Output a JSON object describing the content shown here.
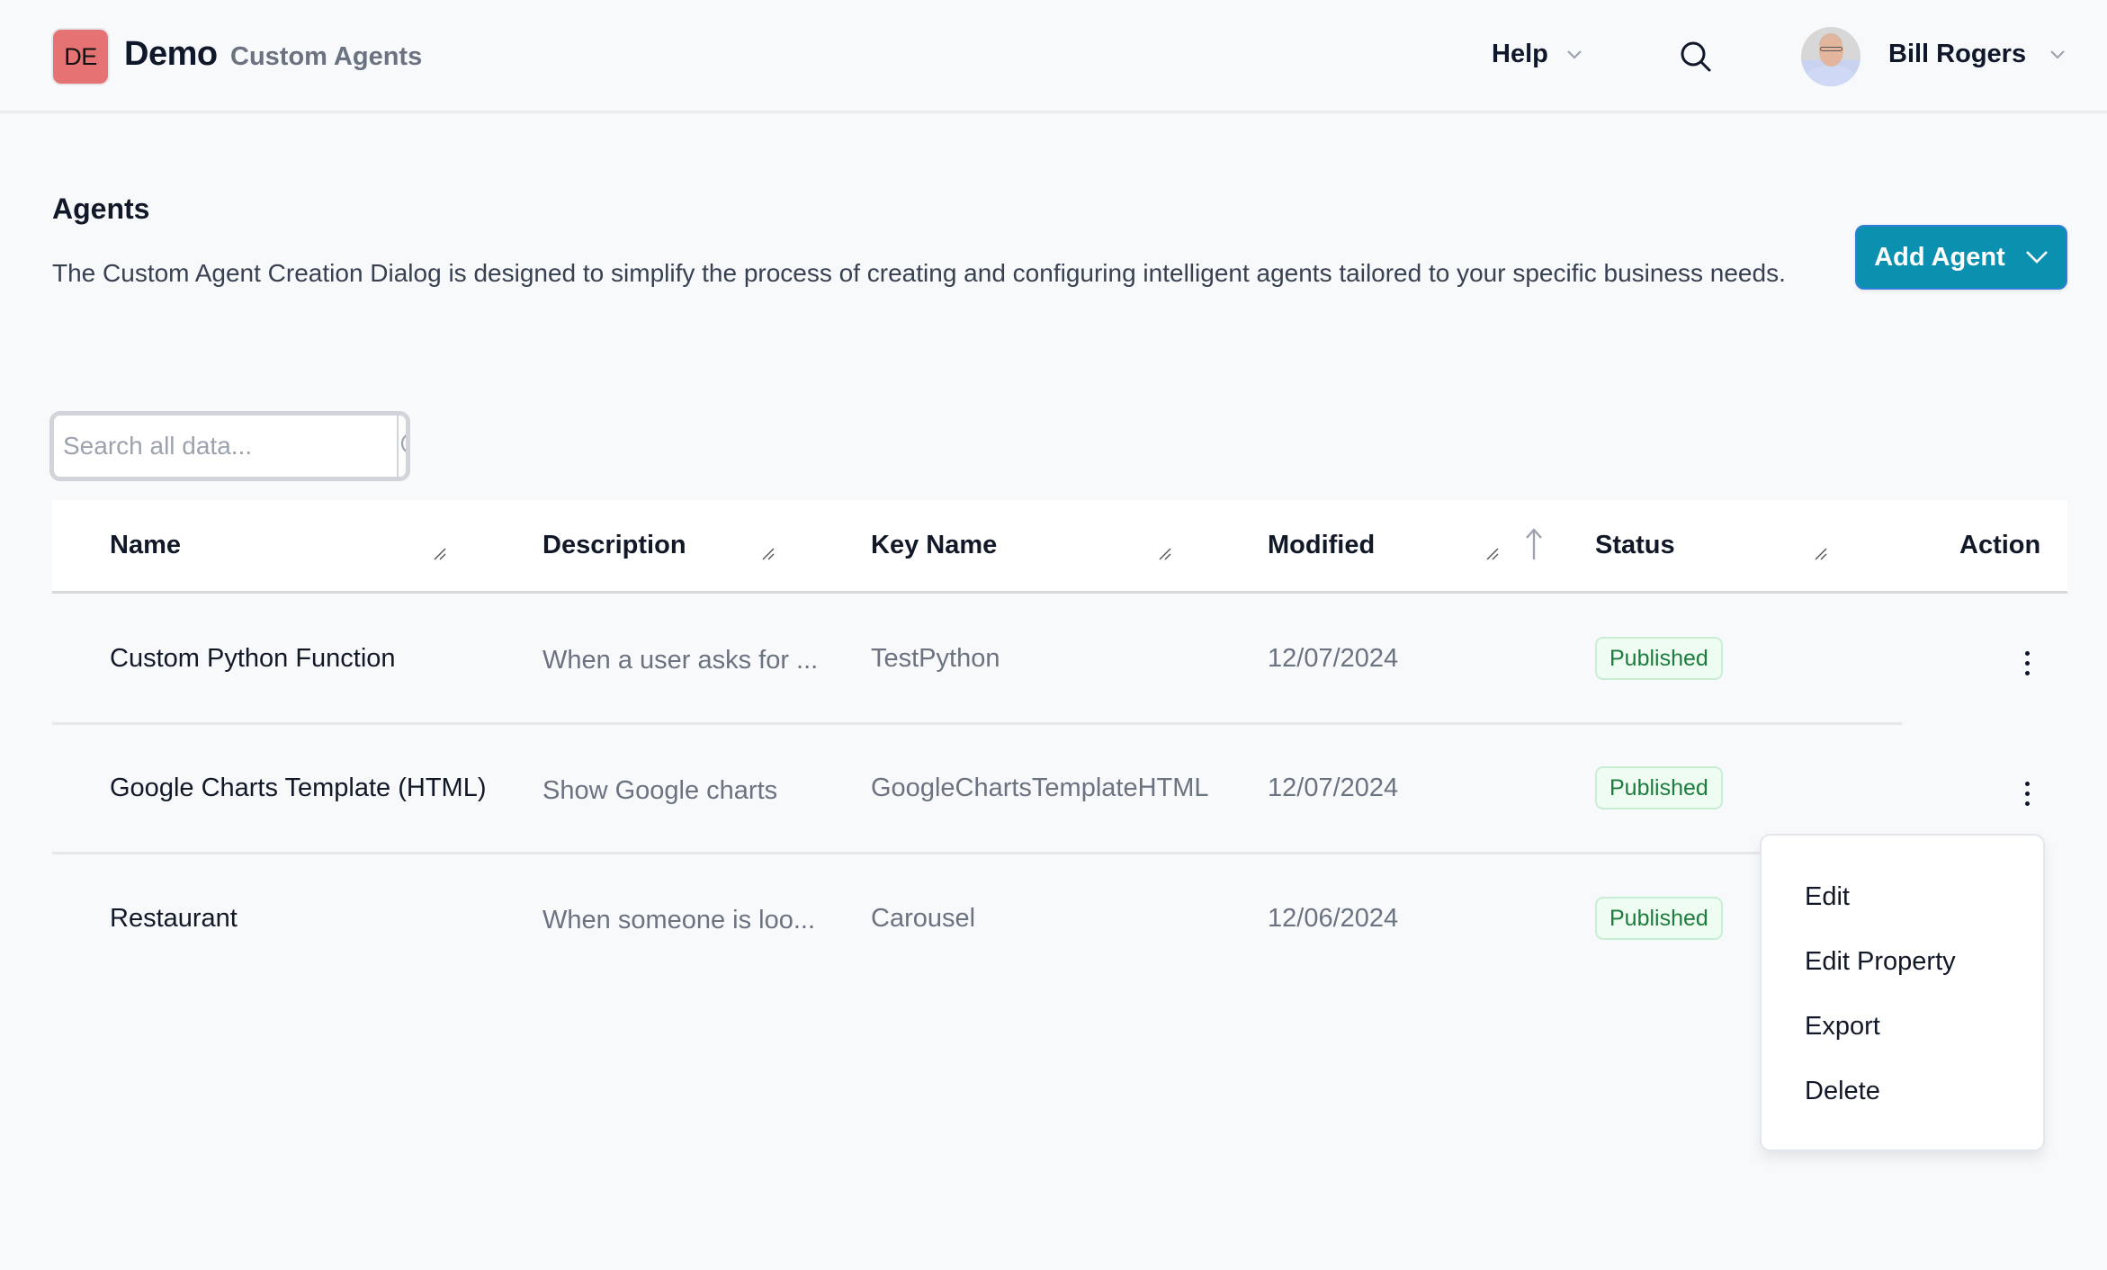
{
  "header": {
    "logo_initials": "DE",
    "app_name": "Demo",
    "section": "Custom Agents",
    "help_label": "Help",
    "user_name": "Bill Rogers"
  },
  "page": {
    "title": "Agents",
    "description": "The Custom Agent Creation Dialog is designed to simplify the process of creating and configuring intelligent agents tailored to your specific business needs.",
    "add_button_label": "Add Agent"
  },
  "search": {
    "placeholder": "Search all data...",
    "value": ""
  },
  "table": {
    "columns": [
      "Name",
      "Description",
      "Key Name",
      "Modified",
      "Status",
      "Action"
    ],
    "sorted_column": "Modified",
    "sort_direction": "ascending",
    "rows": [
      {
        "name": "Custom Python Function",
        "description": "When a user asks for ...",
        "key_name": "TestPython",
        "modified": "12/07/2024",
        "status": "Published"
      },
      {
        "name": "Google Charts Template (HTML)",
        "description": "Show Google charts",
        "key_name": "GoogleChartsTemplateHTML",
        "modified": "12/07/2024",
        "status": "Published"
      },
      {
        "name": "Restaurant",
        "description": "When someone is loo...",
        "key_name": "Carousel",
        "modified": "12/06/2024",
        "status": "Published"
      }
    ]
  },
  "action_menu": {
    "items": [
      "Edit",
      "Edit Property",
      "Export",
      "Delete"
    ]
  },
  "colors": {
    "accent": "#0b90b0",
    "logo_badge": "#e57373",
    "status_published_text": "#1c7c3d",
    "status_published_bg": "#effcf2"
  }
}
